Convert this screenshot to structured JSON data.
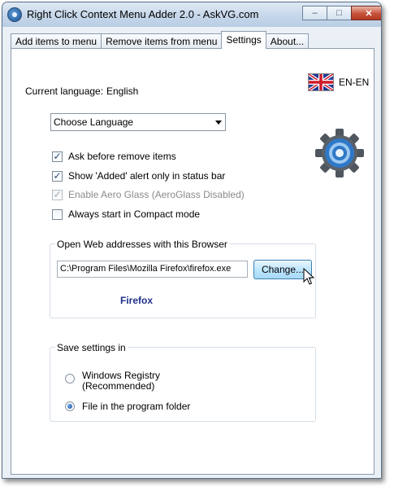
{
  "window": {
    "title": "Right Click Context Menu Adder 2.0  -  AskVG.com",
    "minimize": "–",
    "maximize": "□",
    "close": "✕"
  },
  "tabs": [
    {
      "label": "Add items to menu"
    },
    {
      "label": "Remove items from menu"
    },
    {
      "label": "Settings"
    },
    {
      "label": "About..."
    }
  ],
  "settings": {
    "current_language_label": "Current language:",
    "current_language_value": "English",
    "language_code": "EN-EN",
    "language_combo": "Choose Language",
    "options": [
      {
        "label": "Ask before remove items",
        "checked": true,
        "enabled": true
      },
      {
        "label": "Show 'Added' alert only in status bar",
        "checked": true,
        "enabled": true
      },
      {
        "label": "Enable Aero Glass (AeroGlass Disabled)",
        "checked": true,
        "enabled": false
      },
      {
        "label": "Always start in Compact mode",
        "checked": false,
        "enabled": true
      }
    ],
    "browser_group": {
      "title": "Open Web addresses with this Browser",
      "path": "C:\\Program Files\\Mozilla Firefox\\firefox.exe",
      "change_button": "Change...",
      "browser_name": "Firefox"
    },
    "save_group": {
      "title": "Save settings in",
      "options": [
        {
          "label_line1": "Windows Registry",
          "label_line2": "(Recommended)",
          "selected": false
        },
        {
          "label_line1": "File in the program folder",
          "label_line2": "",
          "selected": true
        }
      ]
    }
  },
  "icons": {
    "app": "app-icon",
    "flag": "uk-flag-icon",
    "settings_gear": "gear-icon",
    "cursor": "mouse-cursor-icon",
    "check": "✓"
  },
  "colors": {
    "browser_name": "#1f2f8a",
    "gear": "#2f78c8"
  }
}
